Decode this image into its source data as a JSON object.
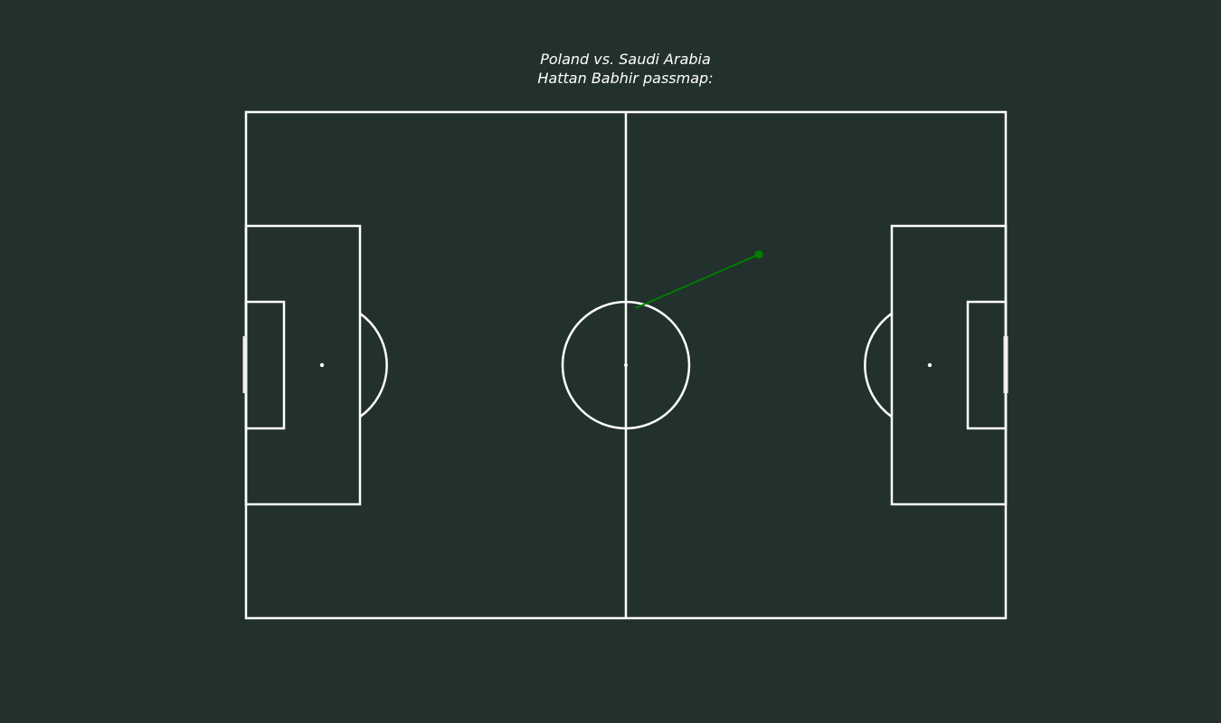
{
  "header": {
    "match": "Poland vs. Saudi Arabia",
    "subtitle": "Hattan Babhir passmap:"
  },
  "colors": {
    "background": "#22312d",
    "pitch_lines": "#ffffff",
    "pass": "#008000"
  },
  "chart_data": {
    "type": "scatter",
    "title": "Poland vs. Saudi Arabia\nHattan Babhir passmap:",
    "pitch": {
      "length": 120,
      "width": 80,
      "units": "StatsBomb-style pitch coordinates"
    },
    "series": [
      {
        "passes": [
          {
            "start": [
              61.5,
              49.0
            ],
            "end": [
              81.0,
              57.5
            ],
            "outcome": "complete",
            "color": "#008000"
          }
        ]
      }
    ],
    "grid": false
  }
}
